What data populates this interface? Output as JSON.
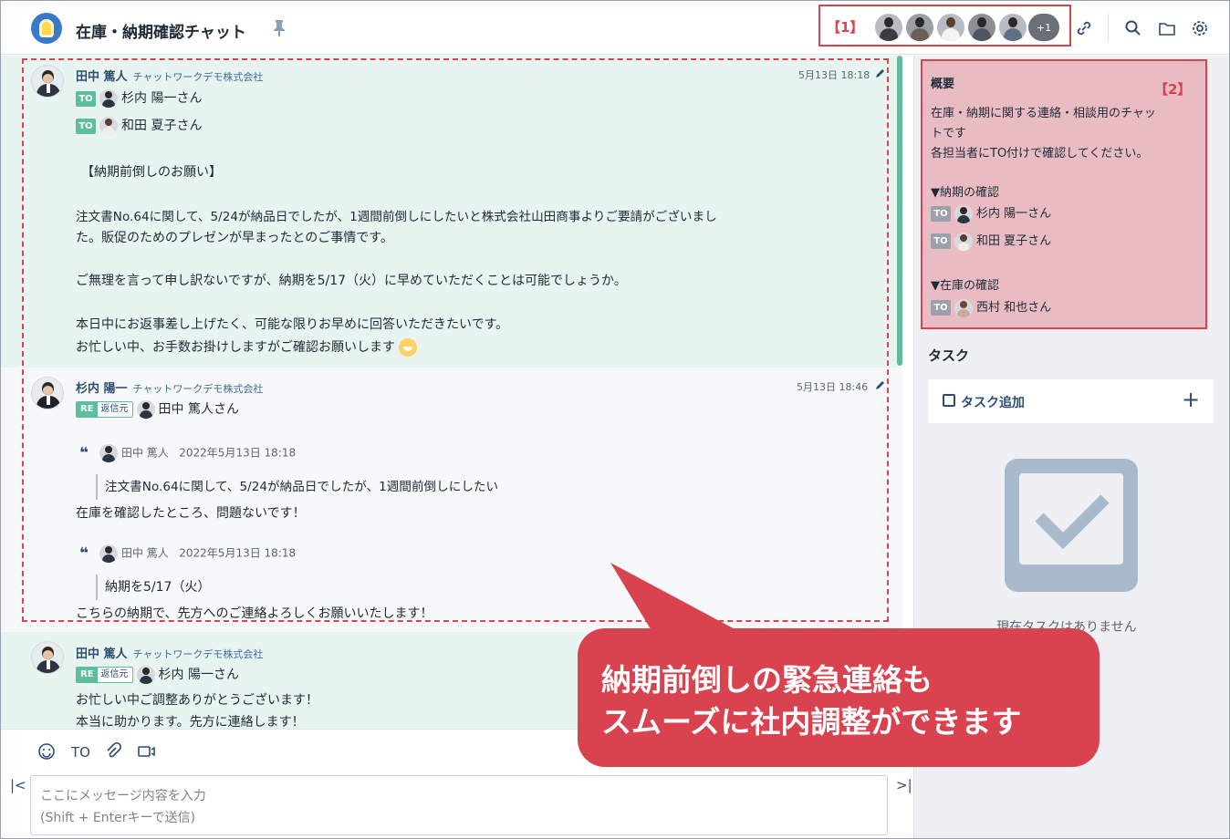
{
  "room": {
    "title": "在庫・納期確認チャット",
    "icon": "lightbulb-icon",
    "annotation_label": "【1】",
    "member_more": "+1"
  },
  "timeline": {
    "messages": [
      {
        "sender": "田中 篤人",
        "company": "チャットワークデモ株式会社",
        "time": "5月13日 18:18",
        "to": [
          "杉内 陽一さん",
          "和田 夏子さん"
        ],
        "lines": [
          "【納期前倒しのお願い】",
          "注文書No.64に関して、5/24が納品日でしたが、1週間前倒しにしたいと株式会社山田商事よりご要請がございまし",
          "た。販促のためのプレゼンが早まったとのご事情です。",
          "ご無理を言って申し訳ないですが、納期を5/17（火）に早めていただくことは可能でしょうか。",
          "本日中にお返事差し上げたく、可能な限りお早めに回答いただきたいです。",
          "お忙しい中、お手数お掛けしますがご確認お願いします"
        ]
      },
      {
        "sender": "杉内 陽一",
        "company": "チャットワークデモ株式会社",
        "time": "5月13日 18:46",
        "re_label": "RE",
        "re_source": "返信元",
        "re_to": "田中 篤人さん",
        "quotes": [
          {
            "author": "田中 篤人",
            "date": "2022年5月13日 18:18",
            "text": "注文書No.64に関して、5/24が納品日でしたが、1週間前倒しにしたい",
            "reply": "在庫を確認したところ、問題ないです！"
          },
          {
            "author": "田中 篤人",
            "date": "2022年5月13日 18:18",
            "text": "納期を5/17（火）",
            "reply": "こちらの納期で、先方へのご連絡よろしくお願いいたします！"
          }
        ]
      },
      {
        "sender": "田中 篤人",
        "company": "チャットワークデモ株式会社",
        "re_label": "RE",
        "re_source": "返信元",
        "re_to": "杉内 陽一さん",
        "lines": [
          "お忙しい中ご調整ありがとうございます！",
          "本当に助かります。先方に連絡します！"
        ]
      }
    ]
  },
  "composer": {
    "to_label": "TO",
    "placeholder": "ここにメッセージ内容を入力\n(Shift + Enterキーで送信)"
  },
  "summary": {
    "title": "概要",
    "annotation_label": "【2】",
    "desc1": "在庫・納期に関する連絡・相談用のチャッ",
    "desc2": "トです",
    "desc3": "各担当者にTO付けで確認してください。",
    "section1": "▼納期の確認",
    "s1_to1": "杉内 陽一さん",
    "s1_to2": "和田 夏子さん",
    "section2": "▼在庫の確認",
    "s2_to1": "西村 和也さん",
    "to_label": "TO"
  },
  "tasks": {
    "title": "タスク",
    "add_label": "タスク追加",
    "empty_text": "現在タスクはありません"
  },
  "callout": {
    "text": "納期前倒しの緊急連絡も\nスムーズに社内調整ができます"
  },
  "colors": {
    "accent": "#5dbe9c",
    "brand_text": "#2d4d73",
    "highlight": "#d9424f"
  }
}
